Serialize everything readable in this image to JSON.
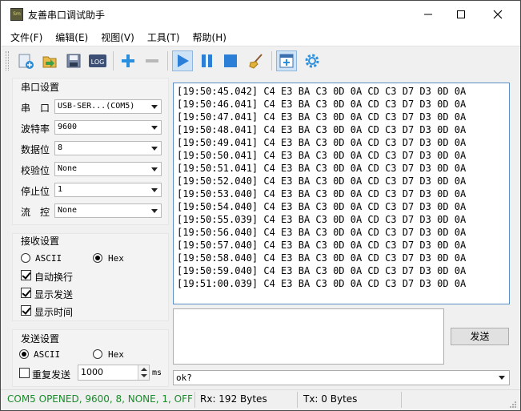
{
  "window": {
    "title": "友善串口调试助手",
    "icon_text": "Sm"
  },
  "menu": [
    "文件(F)",
    "编辑(E)",
    "视图(V)",
    "工具(T)",
    "帮助(H)"
  ],
  "toolbar": {
    "icons": [
      "new-icon",
      "open-icon",
      "save-icon",
      "log-icon",
      "add-icon",
      "remove-icon",
      "play-icon",
      "pause-icon",
      "stop-icon",
      "clear-icon",
      "add-window-icon",
      "settings-icon"
    ],
    "log_label": "LOG"
  },
  "serial_settings": {
    "title": "串口设置",
    "rows": [
      {
        "label": "串　口",
        "value": "USB-SER...(COM5)"
      },
      {
        "label": "波特率",
        "value": "9600"
      },
      {
        "label": "数据位",
        "value": "8"
      },
      {
        "label": "校验位",
        "value": "None"
      },
      {
        "label": "停止位",
        "value": "1"
      },
      {
        "label": "流　控",
        "value": "None"
      }
    ]
  },
  "receive_settings": {
    "title": "接收设置",
    "mode_ascii": "ASCII",
    "mode_hex": "Hex",
    "selected_mode": "Hex",
    "auto_wrap": "自动换行",
    "show_send": "显示发送",
    "show_time": "显示时间"
  },
  "send_settings": {
    "title": "发送设置",
    "mode_ascii": "ASCII",
    "mode_hex": "Hex",
    "selected_mode": "ASCII",
    "repeat_label": "重复发送",
    "repeat_interval": "1000",
    "unit": "ms"
  },
  "receive_lines": [
    "[19:50:45.042] C4 E3 BA C3 0D 0A CD C3 D7 D3 0D 0A",
    "[19:50:46.041] C4 E3 BA C3 0D 0A CD C3 D7 D3 0D 0A",
    "[19:50:47.041] C4 E3 BA C3 0D 0A CD C3 D7 D3 0D 0A",
    "[19:50:48.041] C4 E3 BA C3 0D 0A CD C3 D7 D3 0D 0A",
    "[19:50:49.041] C4 E3 BA C3 0D 0A CD C3 D7 D3 0D 0A",
    "[19:50:50.041] C4 E3 BA C3 0D 0A CD C3 D7 D3 0D 0A",
    "[19:50:51.041] C4 E3 BA C3 0D 0A CD C3 D7 D3 0D 0A",
    "[19:50:52.040] C4 E3 BA C3 0D 0A CD C3 D7 D3 0D 0A",
    "[19:50:53.040] C4 E3 BA C3 0D 0A CD C3 D7 D3 0D 0A",
    "[19:50:54.040] C4 E3 BA C3 0D 0A CD C3 D7 D3 0D 0A",
    "[19:50:55.039] C4 E3 BA C3 0D 0A CD C3 D7 D3 0D 0A",
    "[19:50:56.040] C4 E3 BA C3 0D 0A CD C3 D7 D3 0D 0A",
    "[19:50:57.040] C4 E3 BA C3 0D 0A CD C3 D7 D3 0D 0A",
    "[19:50:58.040] C4 E3 BA C3 0D 0A CD C3 D7 D3 0D 0A",
    "[19:50:59.040] C4 E3 BA C3 0D 0A CD C3 D7 D3 0D 0A",
    "[19:51:00.039] C4 E3 BA C3 0D 0A CD C3 D7 D3 0D 0A"
  ],
  "send": {
    "button_label": "发送",
    "history_value": "ok?"
  },
  "status": {
    "port_state": "COM5 OPENED, 9600, 8, NONE, 1, OFF",
    "rx": "Rx: 192 Bytes",
    "tx": "Tx: 0 Bytes",
    "port_state_color": "#1a8a2a"
  }
}
